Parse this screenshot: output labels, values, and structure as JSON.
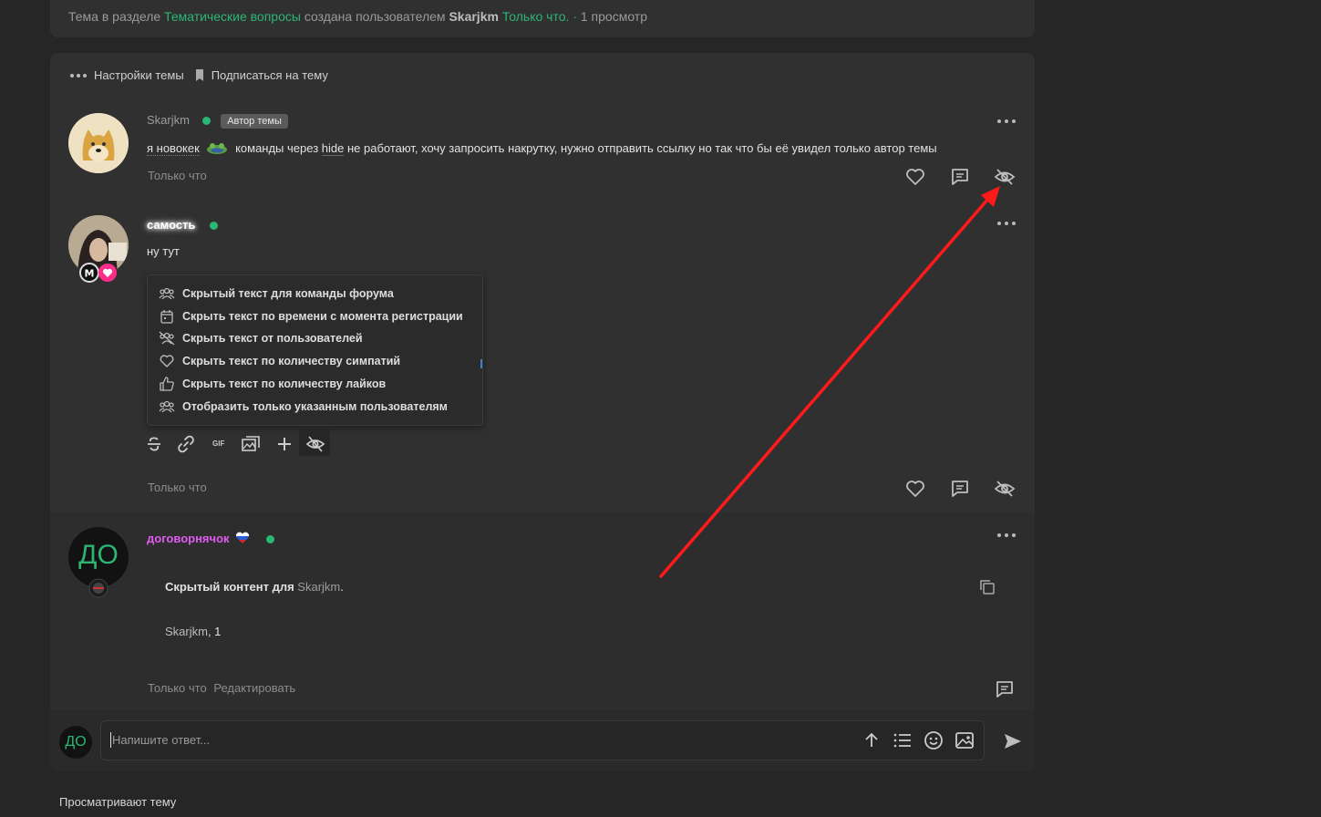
{
  "header": {
    "prefix": "Тема в разделе",
    "section": "Тематические вопросы",
    "created_by": "создана пользователем",
    "author": "Skarjkm",
    "time": "Только что.",
    "views": "1 просмотр"
  },
  "thread_toolbar": {
    "settings": "Настройки темы",
    "subscribe": "Подписаться на тему"
  },
  "posts": [
    {
      "username": "Skarjkm",
      "badge": "Автор темы",
      "text_a": "я новокек",
      "text_b": "команды через",
      "text_hide": "hide",
      "text_c": "не работают, хочу запросить накрутку, нужно отправить ссылку но так что бы её увидел только автор темы",
      "time": "Только что"
    },
    {
      "username": "самость",
      "text": "ну тут",
      "time": "Только что"
    },
    {
      "username": "договорнячок",
      "avatar_text": "ДО",
      "hidden_label": "Скрытый контент для",
      "hidden_user": "Skarjkm",
      "hidden_dot": ".",
      "quote_user": "Skarjkm",
      "quote_rest": ", 1",
      "time": "Только что",
      "edit": "Редактировать"
    }
  ],
  "hide_menu": [
    {
      "icon": "team-icon",
      "label": "Скрытый текст для команды форума"
    },
    {
      "icon": "calendar-icon",
      "label": "Скрыть текст по времени с момента регистрации"
    },
    {
      "icon": "users-off-icon",
      "label": "Скрыть текст от пользователей"
    },
    {
      "icon": "heart-icon",
      "label": "Скрыть текст по количеству симпатий"
    },
    {
      "icon": "thumbs-up-icon",
      "label": "Скрыть текст по количеству лайков"
    },
    {
      "icon": "users-icon",
      "label": "Отобразить только указанным пользователям"
    }
  ],
  "editor_tools": {
    "gif": "GIF"
  },
  "reply": {
    "avatar_text": "ДО",
    "placeholder": "Напишите ответ..."
  },
  "footer": {
    "viewers": "Просматривают тему"
  },
  "colors": {
    "accent_green": "#2bb673",
    "arrow_red": "#ff1a1a",
    "username_pink": "#e05cf0"
  }
}
